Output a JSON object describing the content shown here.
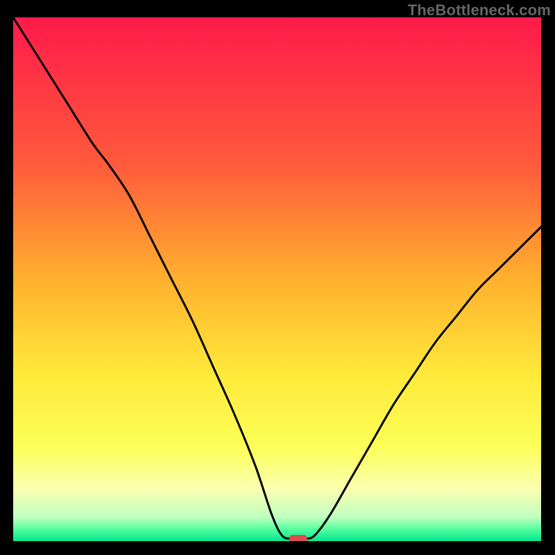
{
  "watermark": "TheBottleneck.com",
  "chart_data": {
    "type": "line",
    "title": "",
    "xlabel": "",
    "ylabel": "",
    "x_range": [
      0,
      100
    ],
    "y_range": [
      0,
      100
    ],
    "series": [
      {
        "name": "curve",
        "x": [
          0,
          5,
          10,
          15,
          18,
          22,
          26,
          30,
          34,
          38,
          42,
          46,
          49,
          51,
          53,
          55,
          57,
          60,
          64,
          68,
          72,
          76,
          80,
          84,
          88,
          92,
          96,
          100
        ],
        "y": [
          100,
          92,
          84,
          76,
          72,
          66,
          58,
          50,
          42,
          33,
          24,
          14,
          5,
          1,
          0.5,
          0.5,
          1,
          5,
          12,
          19,
          26,
          32,
          38,
          43,
          48,
          52,
          56,
          60
        ]
      }
    ],
    "marker": {
      "x": 54,
      "y": 0
    },
    "gradient_stops": [
      {
        "offset": 0,
        "color": "#ff1a4a"
      },
      {
        "offset": 0.28,
        "color": "#ff5a3c"
      },
      {
        "offset": 0.5,
        "color": "#ffb02e"
      },
      {
        "offset": 0.68,
        "color": "#ffe93a"
      },
      {
        "offset": 0.82,
        "color": "#fcff57"
      },
      {
        "offset": 0.9,
        "color": "#faffb0"
      },
      {
        "offset": 0.955,
        "color": "#bfffc0"
      },
      {
        "offset": 0.975,
        "color": "#5cffa0"
      },
      {
        "offset": 1.0,
        "color": "#00e890"
      }
    ]
  }
}
